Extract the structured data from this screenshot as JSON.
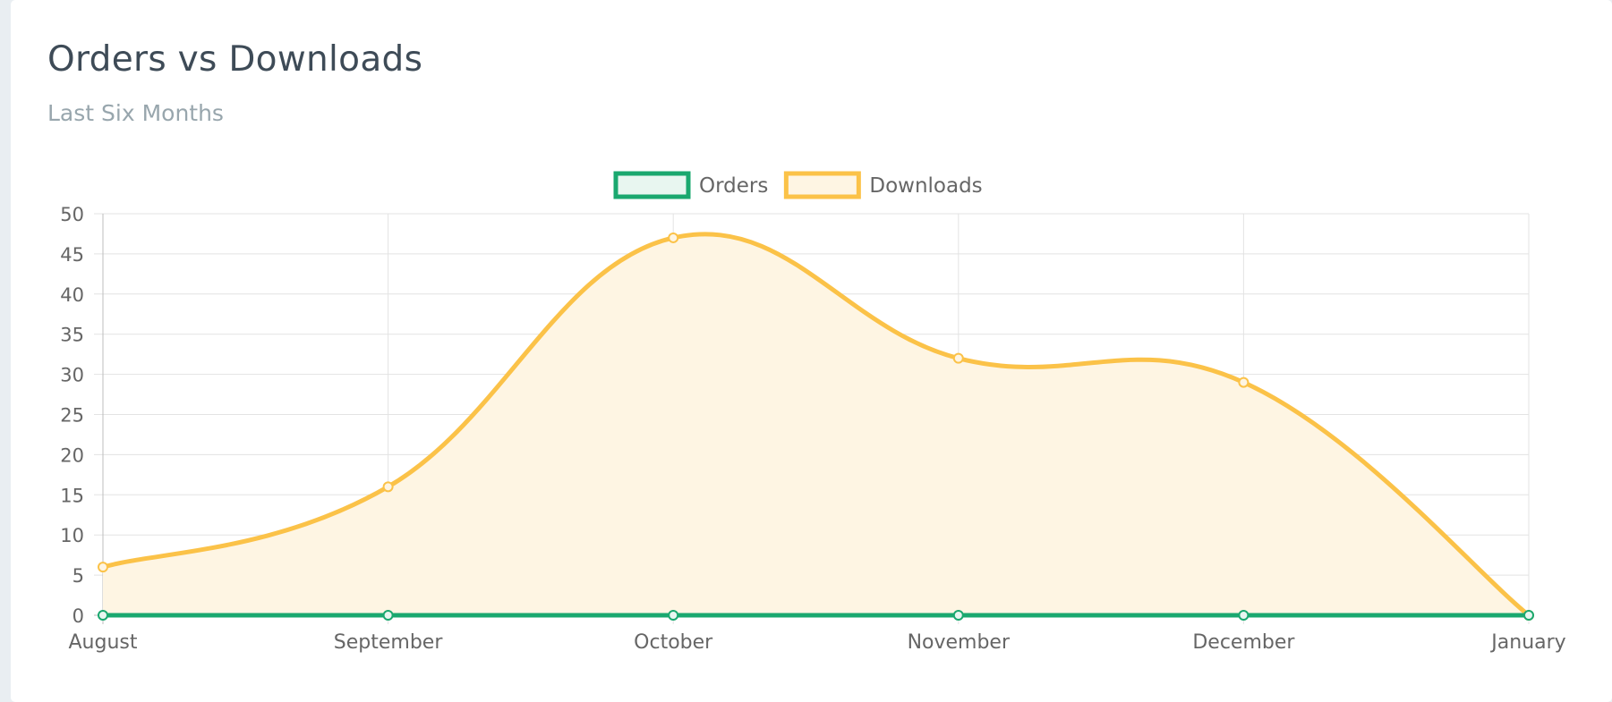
{
  "card": {
    "title": "Orders vs Downloads",
    "subtitle": "Last Six Months"
  },
  "chart_data": {
    "type": "line",
    "categories": [
      "August",
      "September",
      "October",
      "November",
      "December",
      "January"
    ],
    "series": [
      {
        "name": "Orders",
        "values": [
          0,
          0,
          0,
          0,
          0,
          0
        ],
        "color": "#1aa86f",
        "fill": "#e8f6f0",
        "area": false
      },
      {
        "name": "Downloads",
        "values": [
          6,
          16,
          47,
          32,
          29,
          0
        ],
        "color": "#fbc248",
        "fill": "#fef5e3",
        "area": true
      }
    ],
    "yticks": [
      "0",
      "5",
      "10",
      "15",
      "20",
      "25",
      "30",
      "35",
      "40",
      "45",
      "50"
    ],
    "ylim": [
      0,
      50
    ],
    "grid": true,
    "legend_position": "top-center",
    "curve": "smooth"
  }
}
